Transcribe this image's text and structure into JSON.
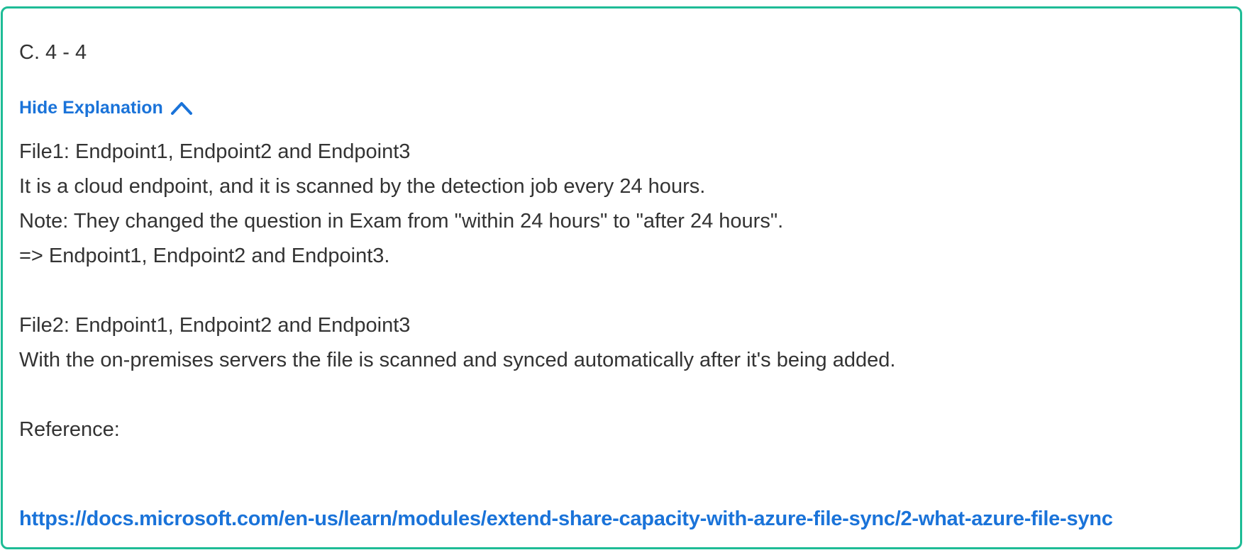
{
  "answer": {
    "option_text": "C. 4 - 4"
  },
  "explanation_toggle": {
    "label": "Hide Explanation",
    "icon": "chevron-up-icon",
    "color": "#1a73d9"
  },
  "explanation": {
    "file1_heading": "File1:  Endpoint1, Endpoint2 and Endpoint3",
    "file1_detail": "It is a cloud endpoint, and it is scanned by the detection job every 24 hours.",
    "file1_note": "Note: They changed the question in Exam from \"within 24 hours\" to \"after 24 hours\".",
    "file1_conclusion": "=> Endpoint1, Endpoint2 and Endpoint3.",
    "file2_heading": "File2: Endpoint1, Endpoint2 and Endpoint3",
    "file2_detail": "With the on-premises servers the file is scanned and synced automatically after it's being added.",
    "reference_label": "Reference:",
    "reference_url": "https://docs.microsoft.com/en-us/learn/modules/extend-share-capacity-with-azure-file-sync/2-what-azure-file-sync"
  },
  "colors": {
    "card_border": "#1ebc96",
    "link": "#1a73d9",
    "text": "#333333"
  }
}
